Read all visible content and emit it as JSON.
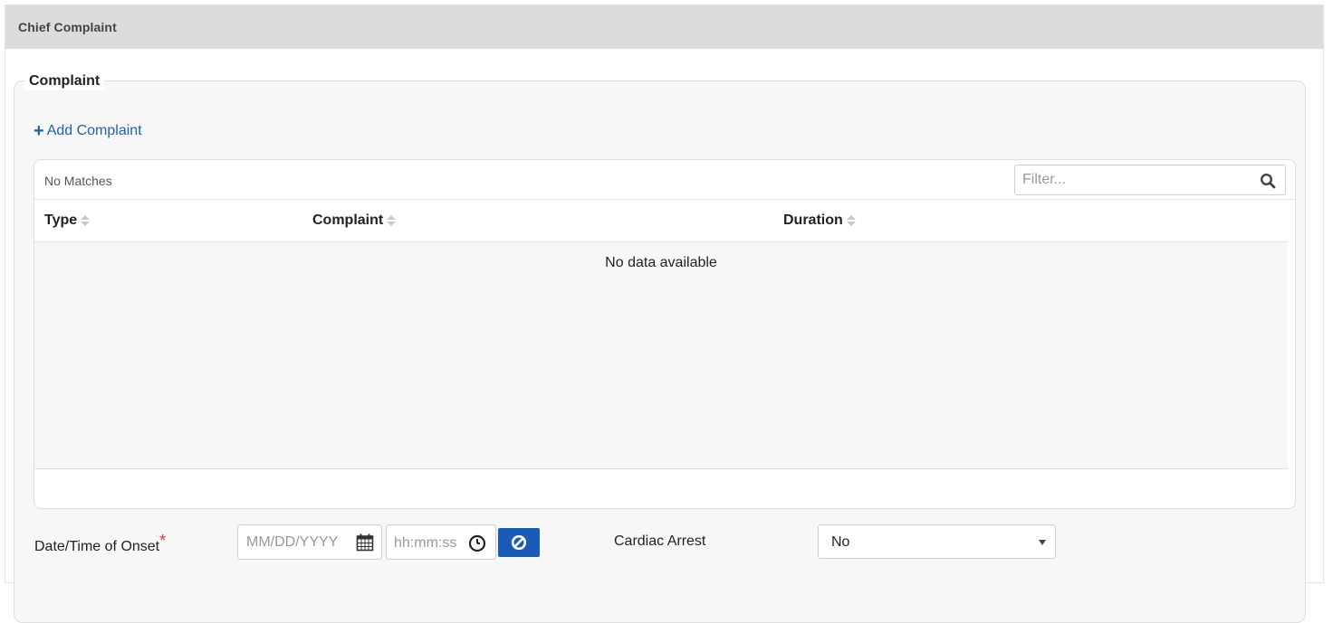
{
  "panel": {
    "title": "Chief Complaint"
  },
  "complaint": {
    "legend": "Complaint",
    "add_label": "Add Complaint",
    "grid": {
      "matches": "No Matches",
      "filter_placeholder": "Filter...",
      "columns": [
        "Type",
        "Complaint",
        "Duration"
      ],
      "empty_message": "No data available"
    }
  },
  "onset": {
    "label": "Date/Time of Onset",
    "required_mark": "*",
    "date_placeholder": "MM/DD/YYYY",
    "time_placeholder": "hh:mm:ss"
  },
  "cardiac": {
    "label": "Cardiac Arrest",
    "value": "No"
  },
  "colors": {
    "link": "#1f5fae",
    "button": "#1a5bb5",
    "required": "#e0343a",
    "header_bg": "#dcdcdc"
  }
}
